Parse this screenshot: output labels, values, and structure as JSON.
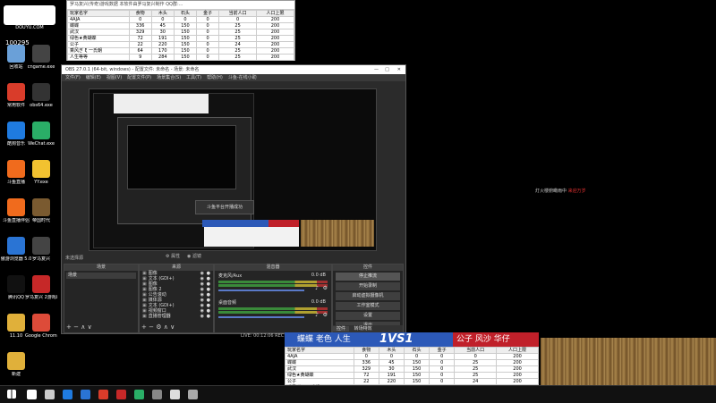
{
  "desktop": {
    "logo_text": "DOUYU.COM",
    "room_number": "100295",
    "icons": [
      {
        "label": "回收站",
        "color": "#6aa0d8"
      },
      {
        "label": "cngame.exe",
        "color": "#444"
      },
      {
        "label": "常用软件",
        "color": "#d93c2a"
      },
      {
        "label": "obs64.exe",
        "color": "#333"
      },
      {
        "label": "酷狗音乐",
        "color": "#1f7be0"
      },
      {
        "label": "WeChat.exe",
        "color": "#2aae67"
      },
      {
        "label": "斗鱼直播",
        "color": "#f06b1d"
      },
      {
        "label": "YY.exe",
        "color": "#f2c230"
      },
      {
        "label": "斗鱼直播伴侣",
        "color": "#f06b1d"
      },
      {
        "label": "帝国时代",
        "color": "#7a5a30"
      },
      {
        "label": "傲游浏览器 5.0",
        "color": "#2a74d4"
      },
      {
        "label": "罗马复兴",
        "color": "#444"
      },
      {
        "label": "腾讯QQ",
        "color": "#111"
      },
      {
        "label": "罗马复兴 2游戏助手",
        "color": "#c62828"
      },
      {
        "label": "11.10",
        "color": "#e0b03a"
      },
      {
        "label": "Google Chrome",
        "color": "#dd4b39"
      },
      {
        "label": "新建",
        "color": "#e0b03a"
      }
    ]
  },
  "stats_window": {
    "title": "罗马复兴(传奇)游戏数据    本软件由罗马复兴制作  QQ群:...",
    "headers": [
      "玩家名字",
      "食物",
      "木头",
      "石头",
      "金子",
      "当前人口",
      "人口上限"
    ],
    "rows": [
      [
        "4AJA",
        "0",
        "0",
        "0",
        "0",
        "0",
        "200"
      ],
      [
        "蝶蝶",
        "336",
        "45",
        "150",
        "0",
        "25",
        "200"
      ],
      [
        "武汉",
        "329",
        "30",
        "150",
        "0",
        "25",
        "200"
      ],
      [
        "绿色★黄蝴蝶",
        "72",
        "191",
        "150",
        "0",
        "25",
        "200"
      ],
      [
        "公子",
        "22",
        "220",
        "150",
        "0",
        "24",
        "200"
      ],
      [
        "乘风ぎ ξ 一氏朝",
        "64",
        "170",
        "150",
        "0",
        "25",
        "200"
      ],
      [
        "人生等等",
        "9",
        "284",
        "150",
        "0",
        "25",
        "200"
      ]
    ]
  },
  "obs": {
    "title": "OBS 27.0.1 (64-bit, windows) - 配置文件: 未命名 - 场景: 未命名",
    "menu": [
      "文件(F)",
      "编辑(E)",
      "视图(V)",
      "配置文件(P)",
      "场景集合(S)",
      "工具(T)",
      "帮助(H)",
      "斗鱼-在线小助"
    ],
    "unselected_source": "未选择源",
    "properties_btn": "属性",
    "filters_btn": "滤镜",
    "docks": {
      "scenes_title": "场景",
      "scene_item": "场景",
      "sources_title": "来源",
      "mixer_title": "混音器",
      "controls_title": "控件"
    },
    "sources": [
      "图像",
      "文本 (GDI+)",
      "图像",
      "图像 2",
      "公告滚动",
      "媒体源",
      "文本 (GDI+)",
      "视频窗口",
      "直播管理器"
    ],
    "mixer": [
      {
        "name": "麦克风/Aux",
        "db": "0.0 dB"
      },
      {
        "name": "桌面音频",
        "db": "0.0 dB"
      }
    ],
    "controls": [
      "停止推流",
      "开始录制",
      "启动虚拟摄像机",
      "工作室模式",
      "设置",
      "退出"
    ],
    "bottom_tabs": [
      "控件",
      "转场特效"
    ],
    "status": "LIVE: 00:12:06  REC: 00:00:00  CPU: 2.5%, 30.00 fps"
  },
  "overlay": {
    "popup": "斗鱼平台开播成功",
    "left_team": "蝶蝶  老色  人生",
    "vs": "1VS1",
    "right_team": "公子  风沙  华仔",
    "message": "灯火楼俯瞰雨中",
    "message_red": "来迎万岁"
  },
  "taskbar": {
    "icons": [
      "#ffffff",
      "#cccccc",
      "#1f7be0",
      "#2a74d4",
      "#d93c2a",
      "#c62828",
      "#2aae67",
      "#888",
      "#dddddd",
      "#aaaaaa"
    ]
  }
}
